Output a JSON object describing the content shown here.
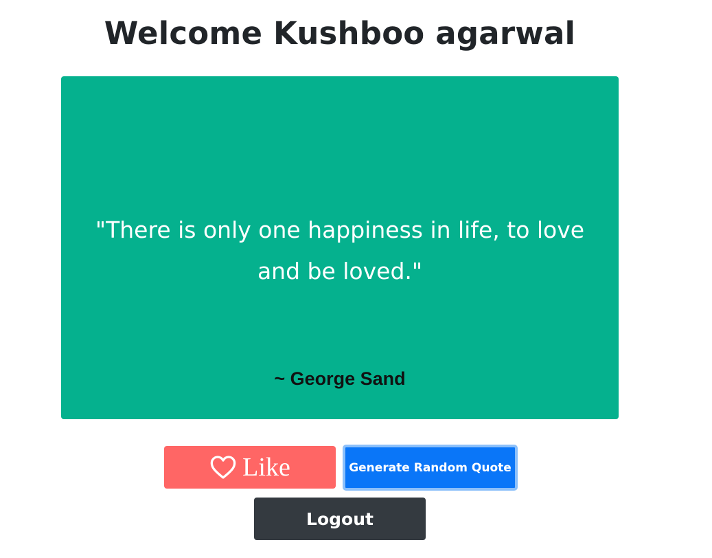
{
  "header": {
    "welcome_text": "Welcome Kushboo agarwal"
  },
  "quote": {
    "text": "\"There is only one happiness in life, to love and be loved.\"",
    "author": "~ George Sand",
    "card_color": "#05b18e"
  },
  "actions": {
    "like_label": "Like",
    "like_icon": "heart-outline-icon",
    "random_quote_label": "Generate Random Quote",
    "logout_label": "Logout"
  },
  "colors": {
    "like_button": "#ff6665",
    "random_button": "#0a76f8",
    "logout_button": "#343a40"
  }
}
